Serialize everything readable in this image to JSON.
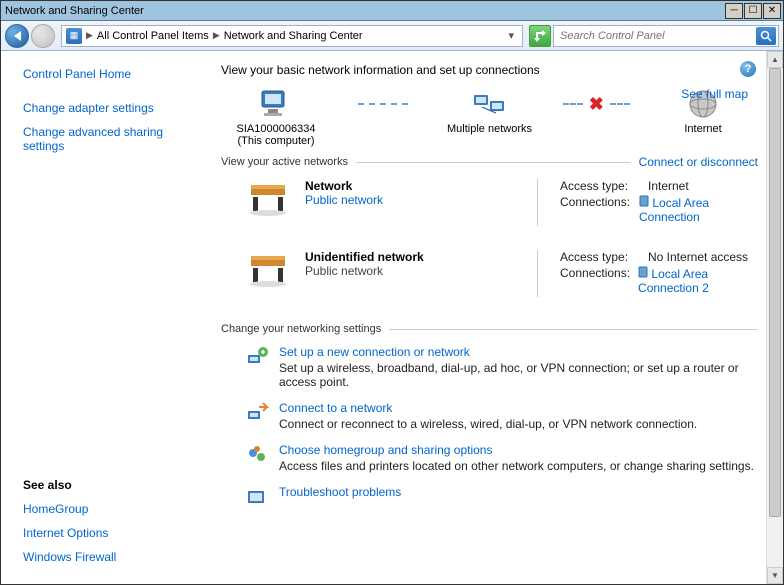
{
  "window_title": "Network and Sharing Center",
  "breadcrumb": {
    "item1": "All Control Panel Items",
    "item2": "Network and Sharing Center"
  },
  "search": {
    "placeholder": "Search Control Panel"
  },
  "sidebar": {
    "home": "Control Panel Home",
    "adapter": "Change adapter settings",
    "advanced": "Change advanced sharing settings",
    "see_also": "See also",
    "homegroup": "HomeGroup",
    "internet_options": "Internet Options",
    "firewall": "Windows Firewall"
  },
  "main": {
    "heading": "View your basic network information and set up connections",
    "see_full_map": "See full map",
    "map": {
      "computer": "SIA1000006334",
      "computer_sub": "(This computer)",
      "middle": "Multiple networks",
      "internet": "Internet"
    },
    "active_section": "View your active networks",
    "connect_link": "Connect or disconnect",
    "networks": [
      {
        "name": "Network",
        "type": "Public network",
        "type_link": true,
        "access_label": "Access type:",
        "access_val": "Internet",
        "conn_label": "Connections:",
        "conn_val": "Local Area Connection"
      },
      {
        "name": "Unidentified network",
        "type": "Public network",
        "type_link": false,
        "access_label": "Access type:",
        "access_val": "No Internet access",
        "conn_label": "Connections:",
        "conn_val": "Local Area Connection 2"
      }
    ],
    "change_section": "Change your networking settings",
    "tasks": [
      {
        "title": "Set up a new connection or network",
        "desc": "Set up a wireless, broadband, dial-up, ad hoc, or VPN connection; or set up a router or access point."
      },
      {
        "title": "Connect to a network",
        "desc": "Connect or reconnect to a wireless, wired, dial-up, or VPN network connection."
      },
      {
        "title": "Choose homegroup and sharing options",
        "desc": "Access files and printers located on other network computers, or change sharing settings."
      },
      {
        "title": "Troubleshoot problems",
        "desc": ""
      }
    ]
  }
}
